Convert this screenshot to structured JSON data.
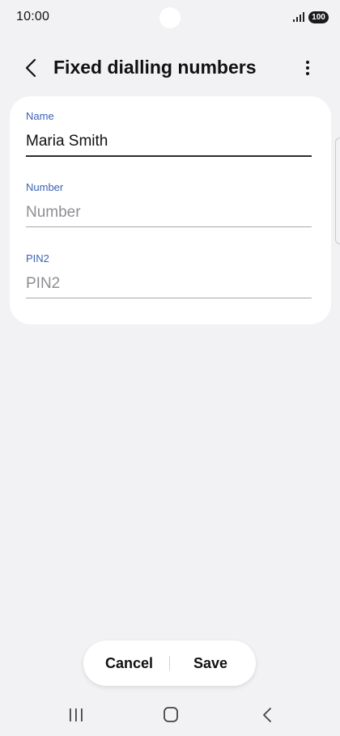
{
  "status_bar": {
    "time": "10:00",
    "battery": "100",
    "icons": [
      "signal-icon",
      "battery-icon"
    ]
  },
  "header": {
    "title": "Fixed dialling numbers",
    "back_icon": "back-arrow-icon",
    "more_icon": "more-vertical-icon"
  },
  "form": {
    "name": {
      "label": "Name",
      "value": "Maria Smith",
      "placeholder": "Name"
    },
    "number": {
      "label": "Number",
      "value": "",
      "placeholder": "Number"
    },
    "pin2": {
      "label": "PIN2",
      "value": "",
      "placeholder": "PIN2"
    }
  },
  "actions": {
    "cancel_label": "Cancel",
    "save_label": "Save"
  },
  "nav_bar": {
    "icons": [
      "recents-icon",
      "home-icon",
      "back-icon"
    ]
  },
  "colors": {
    "background": "#f2f2f4",
    "card": "#ffffff",
    "label_accent": "#3b63b5",
    "text": "#111111",
    "placeholder": "#8e8e93"
  }
}
